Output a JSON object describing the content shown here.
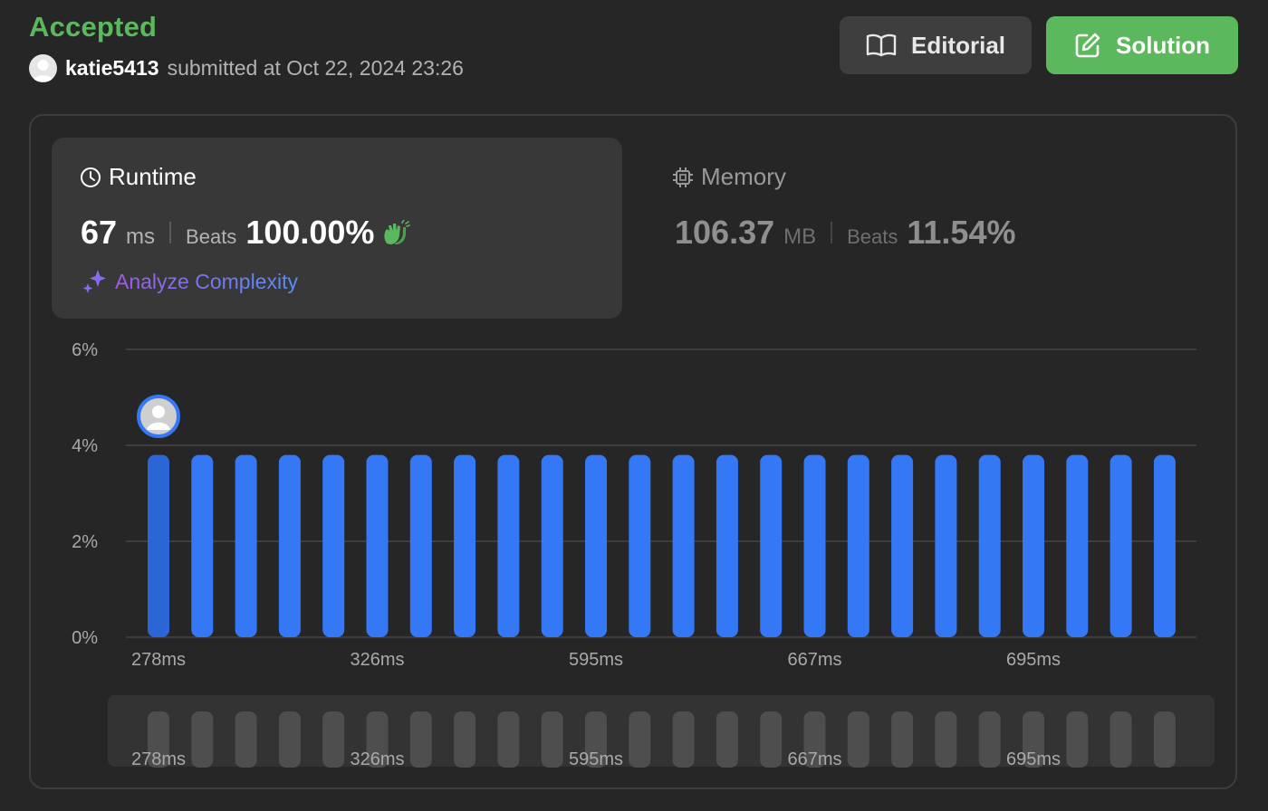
{
  "header": {
    "status": "Accepted",
    "username": "katie5413",
    "submitted_text": "submitted at Oct 22, 2024 23:26"
  },
  "buttons": {
    "editorial": "Editorial",
    "solution": "Solution"
  },
  "runtime": {
    "title": "Runtime",
    "value": "67",
    "unit": "ms",
    "beats_label": "Beats",
    "beats_value": "100.00%"
  },
  "memory": {
    "title": "Memory",
    "value": "106.37",
    "unit": "MB",
    "beats_label": "Beats",
    "beats_value": "11.54%"
  },
  "analyze": {
    "label": "Analyze Complexity"
  },
  "colors": {
    "accepted": "#5cb85c",
    "bar": "#3478f6",
    "bar_highlight": "#2c65d6",
    "mini_bar": "#4e4e4e",
    "grid": "#454545"
  },
  "chart_data": {
    "type": "bar",
    "ylim": [
      0,
      6
    ],
    "yticks": [
      "0%",
      "2%",
      "4%",
      "6%"
    ],
    "ytick_values": [
      0,
      2,
      4,
      6
    ],
    "values": [
      3.8,
      3.8,
      3.8,
      3.8,
      3.8,
      3.8,
      3.8,
      3.8,
      3.8,
      3.8,
      3.8,
      3.8,
      3.8,
      3.8,
      3.8,
      3.8,
      3.8,
      3.8,
      3.8,
      3.8,
      3.8,
      3.8,
      3.8,
      3.8
    ],
    "highlight_index": 0,
    "tick_labels": [
      {
        "index": 0,
        "label": "278ms"
      },
      {
        "index": 5,
        "label": "326ms"
      },
      {
        "index": 10,
        "label": "595ms"
      },
      {
        "index": 15,
        "label": "667ms"
      },
      {
        "index": 20,
        "label": "695ms"
      }
    ],
    "grid": true
  }
}
